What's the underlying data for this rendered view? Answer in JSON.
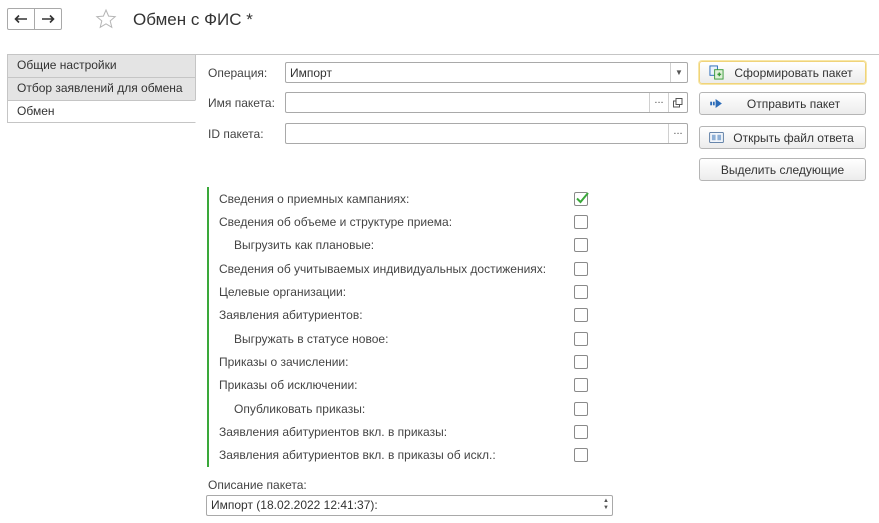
{
  "window": {
    "title": "Обмен с ФИС *"
  },
  "tabs": [
    {
      "label": "Общие настройки",
      "active": false
    },
    {
      "label": "Отбор заявлений для обмена",
      "active": false
    },
    {
      "label": "Обмен",
      "active": true
    }
  ],
  "form": {
    "operation": {
      "label": "Операция:",
      "value": "Импорт"
    },
    "package_name": {
      "label": "Имя пакета:",
      "value": ""
    },
    "package_id": {
      "label": "ID пакета:",
      "value": ""
    },
    "dots": "..."
  },
  "buttons": {
    "create_package": "Сформировать пакет",
    "send_package": "Отправить пакет",
    "open_response": "Открыть файл ответа",
    "select_next": "Выделить следующие"
  },
  "checks": [
    {
      "label": "Сведения о приемных кампаниях:",
      "checked": true,
      "indent": false
    },
    {
      "label": "Сведения об объеме и структуре приема:",
      "checked": false,
      "indent": false
    },
    {
      "label": "Выгрузить как плановые:",
      "checked": false,
      "indent": true
    },
    {
      "label": "Сведения об учитываемых индивидуальных достижениях:",
      "checked": false,
      "indent": false
    },
    {
      "label": "Целевые организации:",
      "checked": false,
      "indent": false
    },
    {
      "label": "Заявления абитуриентов:",
      "checked": false,
      "indent": false
    },
    {
      "label": "Выгружать в статусе новое:",
      "checked": false,
      "indent": true
    },
    {
      "label": "Приказы о зачислении:",
      "checked": false,
      "indent": false
    },
    {
      "label": "Приказы об исключении:",
      "checked": false,
      "indent": false
    },
    {
      "label": "Опубликовать приказы:",
      "checked": false,
      "indent": true
    },
    {
      "label": "Заявления абитуриентов вкл. в приказы:",
      "checked": false,
      "indent": false
    },
    {
      "label": "Заявления абитуриентов вкл. в приказы об искл.:",
      "checked": false,
      "indent": false
    }
  ],
  "description": {
    "label": "Описание пакета:",
    "value": "Импорт (18.02.2022 12:41:37):"
  },
  "colors": {
    "accent_green": "#3aa83a",
    "primary_border": "#f0d37a"
  }
}
